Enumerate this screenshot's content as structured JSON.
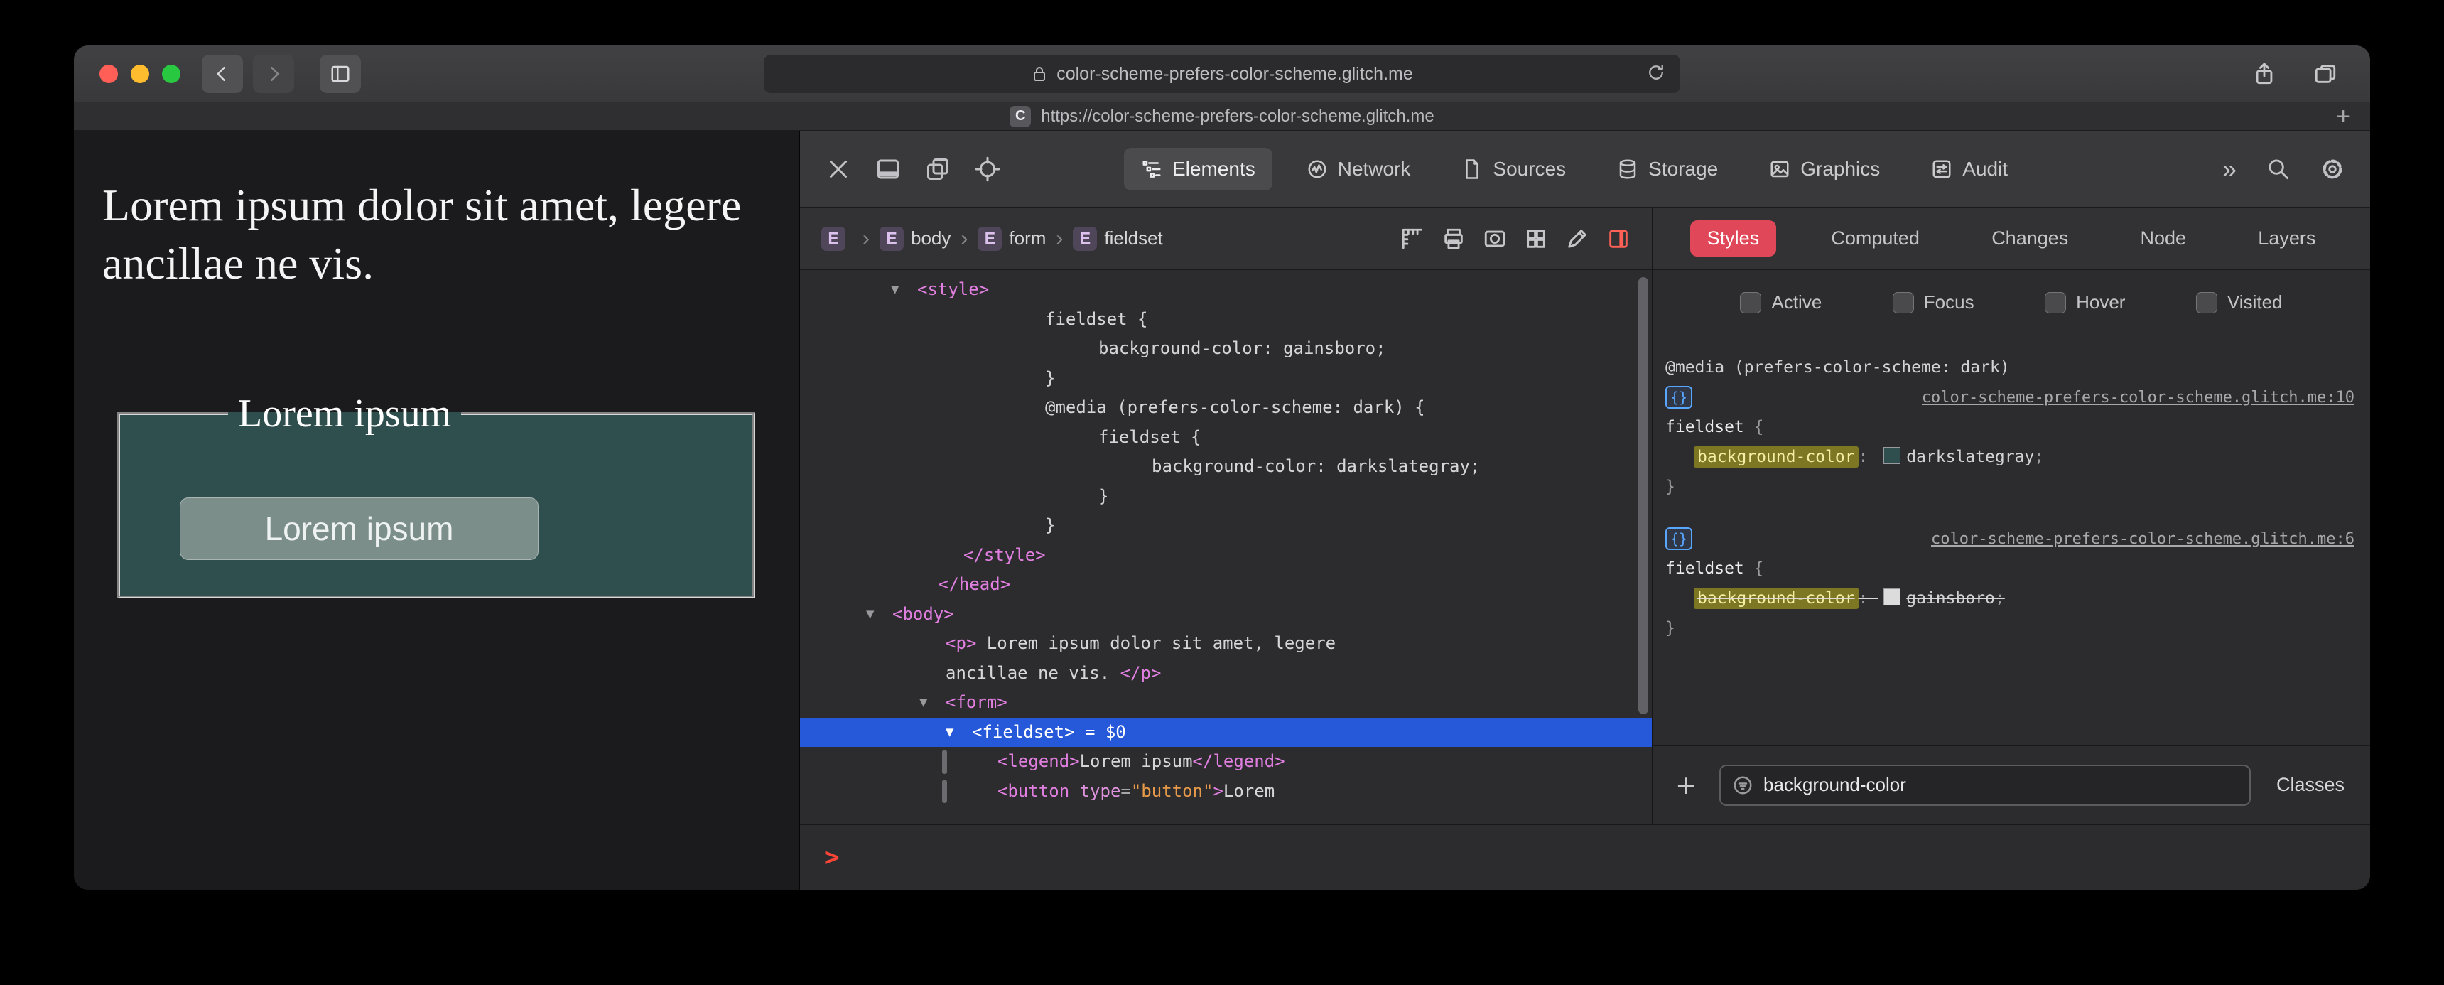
{
  "colors": {
    "selection_blue": "#2559d9",
    "styles_tab_red": "#e0485a",
    "fieldset_bg": "#2f4f4f",
    "page_bg": "#1b1b1d",
    "search_highlight": "#7d7724"
  },
  "chrome": {
    "url": "color-scheme-prefers-color-scheme.glitch.me",
    "tab_url": "https://color-scheme-prefers-color-scheme.glitch.me",
    "favicon": "C",
    "new_tab_label": "+"
  },
  "page": {
    "paragraph": "Lorem ipsum dolor sit amet, legere ancillae ne vis.",
    "legend": "Lorem ipsum",
    "button_label": "Lorem ipsum"
  },
  "devtools": {
    "tabs": [
      {
        "label": "Elements",
        "selected": true
      },
      {
        "label": "Network",
        "selected": false
      },
      {
        "label": "Sources",
        "selected": false
      },
      {
        "label": "Storage",
        "selected": false
      },
      {
        "label": "Graphics",
        "selected": false
      },
      {
        "label": "Audit",
        "selected": false
      }
    ],
    "more_tabs_label": "»",
    "breadcrumbs": [
      {
        "badge": "E",
        "label": ""
      },
      {
        "badge": "E",
        "label": "body"
      },
      {
        "badge": "E",
        "label": "form"
      },
      {
        "badge": "E",
        "label": "fieldset"
      }
    ],
    "crumb_separator": "›",
    "dom_lines": [
      {
        "indent": 165,
        "arrow": true,
        "segs": [
          {
            "c": "tag",
            "t": "<style>"
          }
        ]
      },
      {
        "indent": 345,
        "segs": [
          {
            "c": "css",
            "t": "fieldset {"
          }
        ]
      },
      {
        "indent": 420,
        "segs": [
          {
            "c": "css",
            "t": "background-color: gainsboro;"
          }
        ]
      },
      {
        "indent": 345,
        "segs": [
          {
            "c": "css",
            "t": "}"
          }
        ]
      },
      {
        "indent": 345,
        "segs": [
          {
            "c": "css",
            "t": "@media (prefers-color-scheme: dark) {"
          }
        ]
      },
      {
        "indent": 420,
        "segs": [
          {
            "c": "css",
            "t": "fieldset {"
          }
        ]
      },
      {
        "indent": 495,
        "segs": [
          {
            "c": "css",
            "t": "background-color: darkslategray;"
          }
        ]
      },
      {
        "indent": 420,
        "segs": [
          {
            "c": "css",
            "t": "}"
          }
        ]
      },
      {
        "indent": 345,
        "segs": [
          {
            "c": "css",
            "t": "}"
          }
        ]
      },
      {
        "indent": 230,
        "segs": [
          {
            "c": "tag",
            "t": "</style>"
          }
        ]
      },
      {
        "indent": 195,
        "segs": [
          {
            "c": "tag",
            "t": "</head>"
          }
        ]
      },
      {
        "indent": 130,
        "arrow": true,
        "segs": [
          {
            "c": "tag",
            "t": "<body>"
          }
        ]
      },
      {
        "indent": 205,
        "segs": [
          {
            "c": "tag",
            "t": "<p>"
          },
          {
            "c": "text",
            "t": " Lorem ipsum dolor sit amet, legere"
          }
        ]
      },
      {
        "indent": 205,
        "segs": [
          {
            "c": "text",
            "t": "ancillae ne vis. "
          },
          {
            "c": "tag",
            "t": "</p>"
          }
        ]
      },
      {
        "indent": 205,
        "arrow": true,
        "segs": [
          {
            "c": "tag",
            "t": "<form>"
          }
        ]
      },
      {
        "indent": 242,
        "arrow": true,
        "selected": true,
        "segs": [
          {
            "c": "tag",
            "t": "<fieldset>"
          },
          {
            "c": "eq",
            "t": " = $0"
          }
        ]
      },
      {
        "indent": 278,
        "bar": true,
        "segs": [
          {
            "c": "tag",
            "t": "<legend>"
          },
          {
            "c": "text",
            "t": "Lorem ipsum"
          },
          {
            "c": "tag",
            "t": "</legend>"
          }
        ]
      },
      {
        "indent": 278,
        "bar": true,
        "segs": [
          {
            "c": "tag",
            "t": "<button"
          },
          {
            "c": "attr",
            "t": " type"
          },
          {
            "c": "punct",
            "t": "="
          },
          {
            "c": "val",
            "t": "\"button\""
          },
          {
            "c": "tag",
            "t": ">"
          },
          {
            "c": "text",
            "t": "Lorem"
          }
        ]
      }
    ],
    "styles_panel": {
      "tabs": [
        "Styles",
        "Computed",
        "Changes",
        "Node",
        "Layers"
      ],
      "selected_tab": "Styles",
      "pseudo_toggles": [
        "Active",
        "Focus",
        "Hover",
        "Visited"
      ],
      "rules": [
        {
          "media": "@media (prefers-color-scheme: dark)",
          "source_link": "color-scheme-prefers-color-scheme.glitch.me:10",
          "selector": "fieldset",
          "declarations": [
            {
              "name": "background-color",
              "value": "darkslategray",
              "swatch": "#2f4f4f",
              "highlighted": true,
              "overridden": false
            }
          ]
        },
        {
          "media": "",
          "source_link": "color-scheme-prefers-color-scheme.glitch.me:6",
          "selector": "fieldset",
          "declarations": [
            {
              "name": "background-color",
              "value": "gainsboro",
              "swatch": "#dcdcdc",
              "highlighted": true,
              "overridden": true
            }
          ]
        }
      ],
      "filter_value": "background-color",
      "add_rule_label": "+",
      "classes_label": "Classes"
    },
    "console_prompt": ">"
  }
}
